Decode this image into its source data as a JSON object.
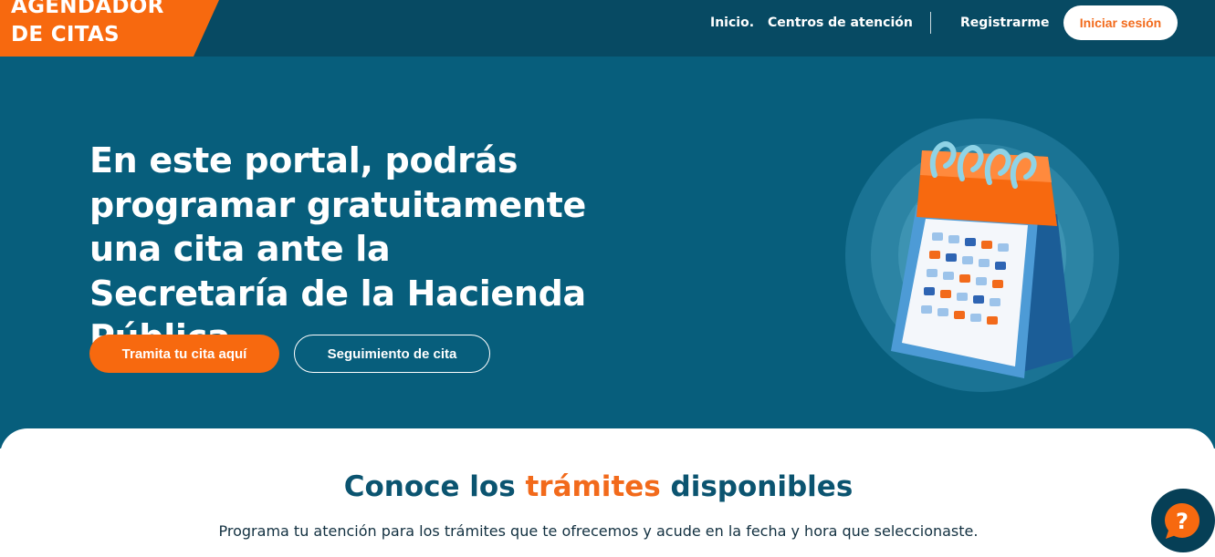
{
  "header": {
    "logo_line1": "AGENDADOR",
    "logo_line2": "DE CITAS",
    "nav": {
      "inicio": "Inicio.",
      "centros": "Centros de atención",
      "registrarme": "Registrarme",
      "login": "Iniciar sesión"
    }
  },
  "hero": {
    "title": "En este portal, podrás programar gratuitamente una cita ante la Secretaría de la Hacienda Pública",
    "primary_button": "Tramita tu cita aquí",
    "secondary_button": "Seguimiento de cita",
    "illustration_icon": "calendar-icon"
  },
  "section": {
    "title_part1": "Conoce los",
    "title_highlight": "trámites",
    "title_part2": "disponibles",
    "subtitle": "Programa tu atención para los trámites que te ofrecemos y acude en la fecha y hora que seleccionaste."
  },
  "help": {
    "icon": "question-chat-icon"
  },
  "colors": {
    "header_bg": "#074a63",
    "hero_bg": "#075e7c",
    "accent_orange": "#f7690f",
    "title_blue": "#0b5470"
  }
}
